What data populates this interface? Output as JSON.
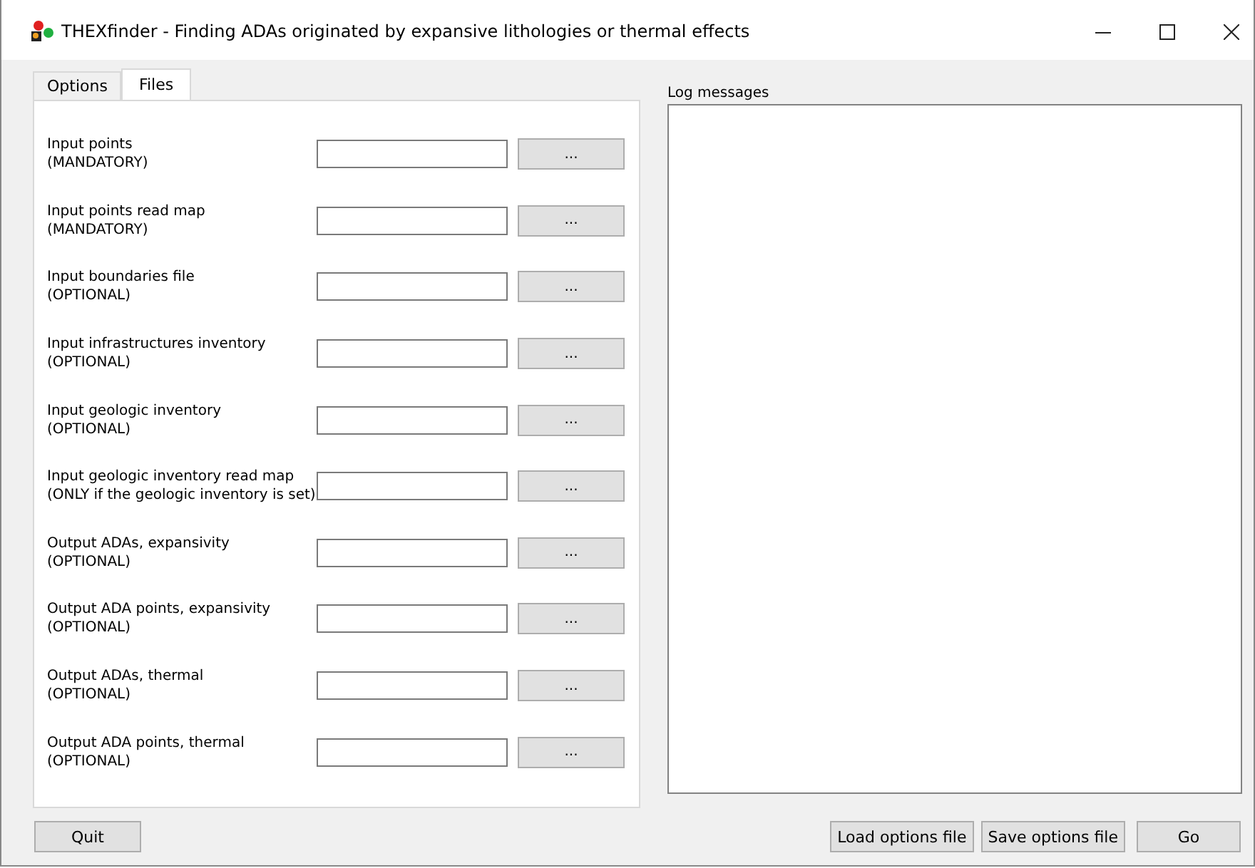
{
  "window": {
    "title": "THEXfinder - Finding ADAs originated by expansive lithologies or thermal effects"
  },
  "tabs": [
    {
      "label": "Options",
      "selected": false
    },
    {
      "label": "Files",
      "selected": true
    }
  ],
  "files": [
    {
      "label": "Input points",
      "note": "(MANDATORY)",
      "button": "..."
    },
    {
      "label": "Input points read map",
      "note": "(MANDATORY)",
      "button": "..."
    },
    {
      "label": "Input boundaries file",
      "note": "(OPTIONAL)",
      "button": "..."
    },
    {
      "label": "Input infrastructures inventory",
      "note": "(OPTIONAL)",
      "button": "..."
    },
    {
      "label": "Input geologic inventory",
      "note": "(OPTIONAL)",
      "button": "..."
    },
    {
      "label": "Input geologic inventory read map",
      "note": "(ONLY if the geologic inventory is set)",
      "button": "..."
    },
    {
      "label": "Output ADAs, expansivity",
      "note": "(OPTIONAL)",
      "button": "..."
    },
    {
      "label": "Output ADA points, expansivity",
      "note": "(OPTIONAL)",
      "button": "..."
    },
    {
      "label": "Output ADAs, thermal",
      "note": "(OPTIONAL)",
      "button": "..."
    },
    {
      "label": "Output ADA points, thermal",
      "note": "(OPTIONAL)",
      "button": "..."
    }
  ],
  "log": {
    "label": "Log messages"
  },
  "buttons": {
    "left": [
      "Quit"
    ],
    "right": [
      "Load options file",
      "Save options file",
      "Go"
    ]
  }
}
